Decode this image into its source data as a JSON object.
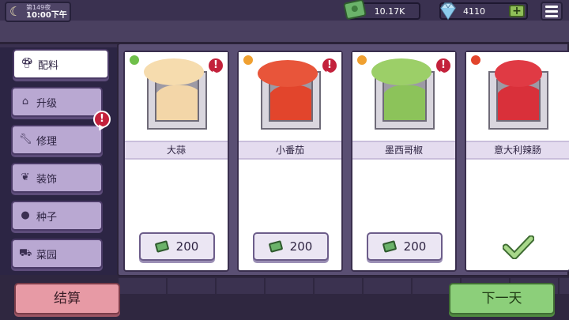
{
  "hud": {
    "day_label": "第149夜",
    "time_label": "10:00下午",
    "money": "10.17K",
    "gems": "4110",
    "plus_label": "+"
  },
  "sidebar": {
    "items": [
      {
        "label": "配料",
        "icon": "mushroom-icon",
        "active": true
      },
      {
        "label": "升级",
        "icon": "house-icon"
      },
      {
        "label": "修理",
        "icon": "wrench-icon",
        "alert": true
      },
      {
        "label": "装饰",
        "icon": "plant-pot-icon"
      },
      {
        "label": "种子",
        "icon": "seed-icon"
      },
      {
        "label": "菜园",
        "icon": "wheelbarrow-icon"
      }
    ]
  },
  "cards": [
    {
      "name": "大蒜",
      "price": "200",
      "color": "#f3d6a8",
      "tag_color": "#6fbf4a",
      "alert": true,
      "owned": false
    },
    {
      "name": "小番茄",
      "price": "200",
      "color": "#e2452c",
      "tag_color": "#f0a030",
      "alert": true,
      "owned": false
    },
    {
      "name": "墨西哥椒",
      "price": "200",
      "color": "#8cc35a",
      "tag_color": "#f0a030",
      "alert": true,
      "owned": false
    },
    {
      "name": "意大利辣肠",
      "price": "",
      "color": "#d9303a",
      "tag_color": "#e2452c",
      "alert": false,
      "owned": true
    }
  ],
  "alert_symbol": "!",
  "buttons": {
    "settle": "结算",
    "next_day": "下一天"
  },
  "colors": {
    "accent_green": "#8ccf7a",
    "accent_pink": "#e79aa5",
    "alert_red": "#c3213b"
  }
}
